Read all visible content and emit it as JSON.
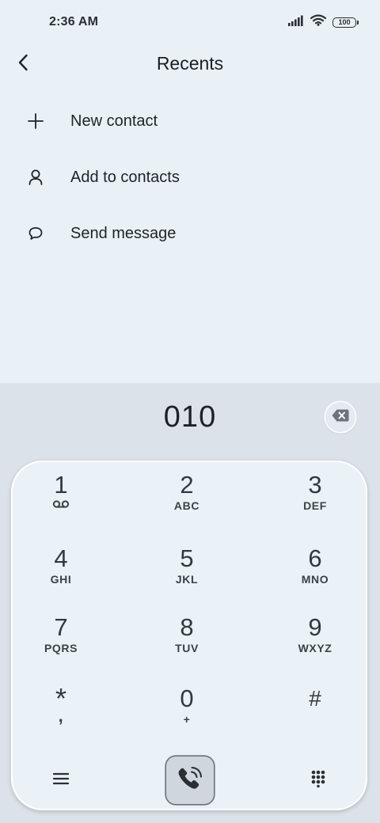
{
  "status": {
    "time": "2:36 AM",
    "battery": "100"
  },
  "header": {
    "title": "Recents"
  },
  "menu": [
    {
      "label": "New contact",
      "icon": "plus-icon"
    },
    {
      "label": "Add to contacts",
      "icon": "person-icon"
    },
    {
      "label": "Send message",
      "icon": "chat-bubble-icon"
    }
  ],
  "dialer": {
    "number": "010",
    "keys": [
      {
        "digit": "1",
        "letters": ""
      },
      {
        "digit": "2",
        "letters": "ABC"
      },
      {
        "digit": "3",
        "letters": "DEF"
      },
      {
        "digit": "4",
        "letters": "GHI"
      },
      {
        "digit": "5",
        "letters": "JKL"
      },
      {
        "digit": "6",
        "letters": "MNO"
      },
      {
        "digit": "7",
        "letters": "PQRS"
      },
      {
        "digit": "8",
        "letters": "TUV"
      },
      {
        "digit": "9",
        "letters": "WXYZ"
      },
      {
        "digit": "*",
        "letters": ","
      },
      {
        "digit": "0",
        "letters": "+"
      },
      {
        "digit": "#",
        "letters": ""
      }
    ]
  }
}
